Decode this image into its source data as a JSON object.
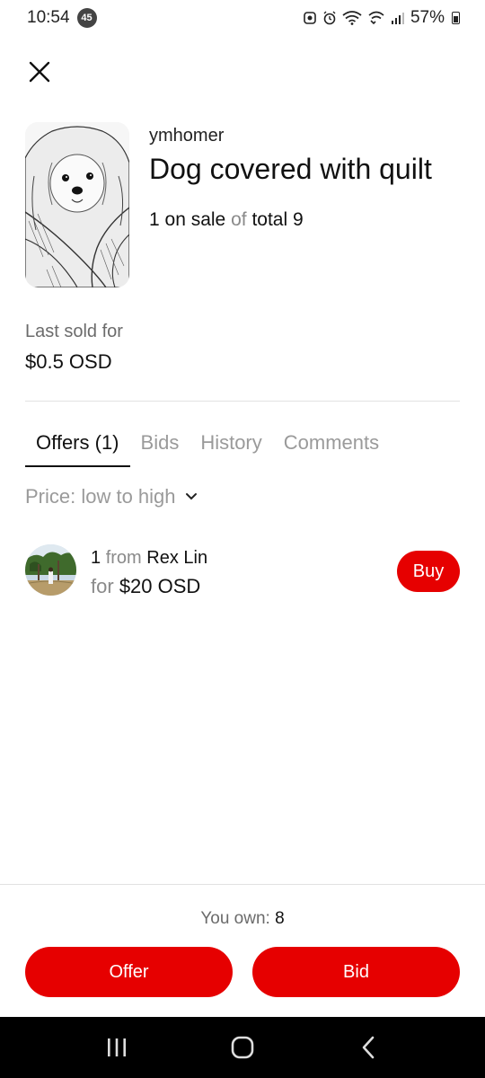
{
  "status_bar": {
    "time": "10:54",
    "notification_count": "45",
    "battery": "57%"
  },
  "item": {
    "creator": "ymhomer",
    "title": "Dog covered with quilt",
    "edition_on_sale": "1 on sale",
    "edition_of": "of",
    "edition_total": "total 9",
    "last_sold_label": "Last sold for",
    "last_sold_value": "$0.5 OSD"
  },
  "tabs": [
    {
      "label": "Offers (1)",
      "active": true
    },
    {
      "label": "Bids",
      "active": false
    },
    {
      "label": "History",
      "active": false
    },
    {
      "label": "Comments",
      "active": false
    }
  ],
  "sort": {
    "label": "Price: low to high"
  },
  "offers": [
    {
      "quantity": "1",
      "from_word": "from",
      "seller": "Rex Lin",
      "for_word": "for",
      "price": "$20 OSD",
      "action_label": "Buy"
    }
  ],
  "footer": {
    "you_own_label": "You own:",
    "you_own_value": "8",
    "offer_label": "Offer",
    "bid_label": "Bid"
  },
  "colors": {
    "accent": "#e60000",
    "text": "#111111",
    "muted": "#8a8a8a"
  }
}
